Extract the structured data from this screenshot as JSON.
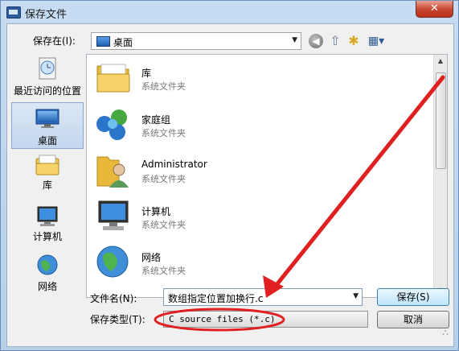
{
  "window": {
    "title": "保存文件",
    "close_glyph": "✕"
  },
  "toolbar": {
    "save_in_label": "保存在(I):",
    "location": "桌面",
    "back_icon": "back-arrow-icon",
    "up_icon": "up-folder-icon",
    "new_folder_icon": "new-folder-icon",
    "view_icon": "view-menu-icon"
  },
  "places": [
    {
      "label": "最近访问的位置",
      "icon": "recent-places-icon"
    },
    {
      "label": "桌面",
      "icon": "desktop-icon",
      "selected": true
    },
    {
      "label": "库",
      "icon": "libraries-icon"
    },
    {
      "label": "计算机",
      "icon": "computer-icon"
    },
    {
      "label": "网络",
      "icon": "network-icon"
    }
  ],
  "files": [
    {
      "name": "库",
      "type": "系统文件夹",
      "icon": "libraries-folder-icon"
    },
    {
      "name": "家庭组",
      "type": "系统文件夹",
      "icon": "homegroup-icon"
    },
    {
      "name": "Administrator",
      "type": "系统文件夹",
      "icon": "user-folder-icon"
    },
    {
      "name": "计算机",
      "type": "系统文件夹",
      "icon": "computer-icon"
    },
    {
      "name": "网络",
      "type": "系统文件夹",
      "icon": "network-icon"
    }
  ],
  "bottom": {
    "filename_label": "文件名(N):",
    "filename_value": "数组指定位置加换行.c",
    "filetype_label": "保存类型(T):",
    "filetype_value": "C source files (*.c)",
    "save_button": "保存(S)",
    "cancel_button": "取消"
  },
  "colors": {
    "annotation_red": "#e02020",
    "selection": "#c3d6ee"
  }
}
